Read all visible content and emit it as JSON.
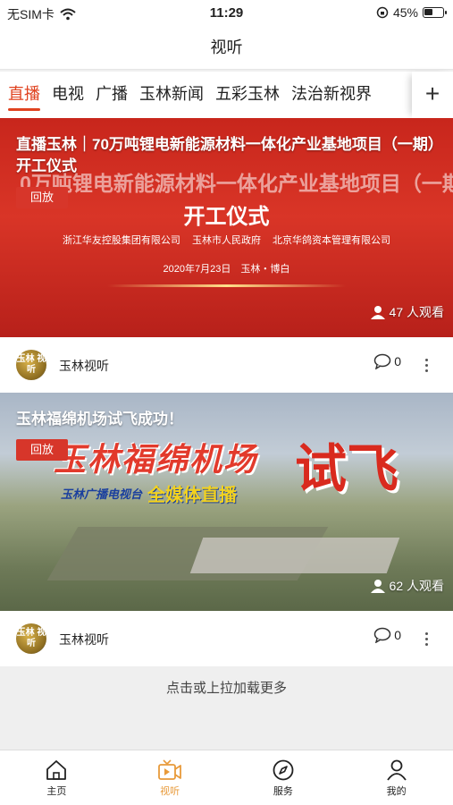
{
  "status_bar": {
    "carrier": "无SIM卡",
    "time": "11:29",
    "battery": "45%",
    "battery_level": 0.45
  },
  "header": {
    "title": "视听"
  },
  "tabs": [
    {
      "label": "直播",
      "active": true
    },
    {
      "label": "电视",
      "active": false
    },
    {
      "label": "广播",
      "active": false
    },
    {
      "label": "玉林新闻",
      "active": false
    },
    {
      "label": "五彩玉林",
      "active": false
    },
    {
      "label": "法治新视界",
      "active": false
    }
  ],
  "tabs_add_icon": "plus-icon",
  "cards": [
    {
      "title": "直播玉林｜70万吨锂电新能源材料一体化产业基地项目（一期）开工仪式",
      "badge": "回放",
      "viewers": "47 人观看",
      "source": "玉林视听",
      "comments": "0",
      "avatar_text": "玉林 视听",
      "poster": {
        "line1": "0万吨锂电新能源材料一体化产业基地项目（一期",
        "line2": "开工仪式",
        "orgs": "浙江华友控股集团有限公司 玉林市人民政府 北京华鸽资本管理有限公司",
        "date": "2020年7月23日 玉林・博白"
      }
    },
    {
      "title": "玉林福绵机场试飞成功！",
      "badge": "回放",
      "viewers": "62 人观看",
      "source": "玉林视听",
      "comments": "0",
      "avatar_text": "玉林 视听",
      "poster": {
        "headline": "玉林福绵机场",
        "headline2": "试飞",
        "station": "玉林广播电视台",
        "media": "全媒体直播"
      }
    }
  ],
  "load_more": "点击或上拉加载更多",
  "bottom_nav": [
    {
      "label": "主页",
      "icon": "home-icon",
      "active": false
    },
    {
      "label": "视听",
      "icon": "video-icon",
      "active": true
    },
    {
      "label": "服务",
      "icon": "compass-icon",
      "active": false
    },
    {
      "label": "我的",
      "icon": "user-icon",
      "active": false
    }
  ],
  "colors": {
    "accent": "#e0421f",
    "nav_active": "#e89a3a",
    "badge": "#d7362a"
  }
}
